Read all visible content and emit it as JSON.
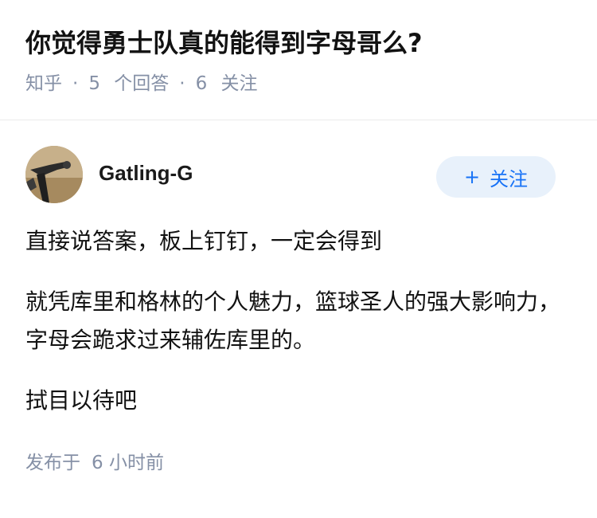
{
  "question": {
    "title": "你觉得勇士队真的能得到字母哥么?",
    "source": "知乎",
    "answer_count": "5",
    "answer_label": "个回答",
    "follower_count": "6",
    "follower_label": "关注"
  },
  "answer": {
    "author": "Gatling-G",
    "follow_button": "关注",
    "paragraphs": [
      "直接说答案，板上钉钉，一定会得到",
      "就凭库里和格林的个人魅力，篮球圣人的强大影响力，字母会跪求过来辅佐库里的。",
      "拭目以待吧"
    ],
    "published_prefix": "发布于",
    "published_time": "6 小时前"
  },
  "colors": {
    "accent": "#1772f6",
    "follow_bg": "#e8f1fb",
    "meta_gray": "#8590a6"
  }
}
